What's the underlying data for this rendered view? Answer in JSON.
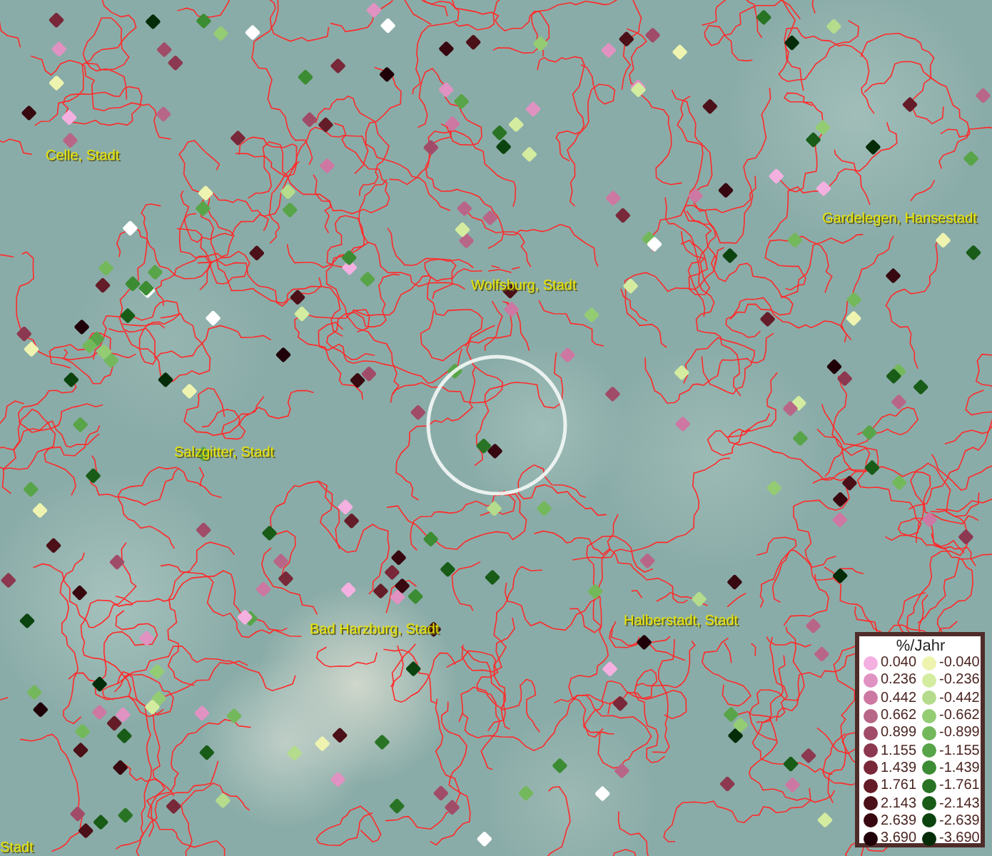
{
  "map": {
    "place_labels": [
      {
        "text": "Celle, Stadt"
      },
      {
        "text": "Gardelegen, Hansestadt"
      },
      {
        "text": "Wolfsburg, Stadt"
      },
      {
        "text": "Salzgitter, Stadt"
      },
      {
        "text": "Bad Harzburg, Stadt"
      },
      {
        "text": "Halberstadt, Stadt"
      },
      {
        "text": "Stadt"
      }
    ]
  },
  "legend": {
    "title": "%/Jahr",
    "entries": [
      {
        "label": "0.040",
        "color": "#f4b0e0"
      },
      {
        "label": "-0.040",
        "color": "#eef4b0"
      },
      {
        "label": "0.236",
        "color": "#e092c2"
      },
      {
        "label": "-0.236",
        "color": "#d4eca0"
      },
      {
        "label": "0.442",
        "color": "#cc78a2"
      },
      {
        "label": "-0.442",
        "color": "#b4dc8c"
      },
      {
        "label": "0.662",
        "color": "#b86688"
      },
      {
        "label": "-0.662",
        "color": "#94cc74"
      },
      {
        "label": "0.899",
        "color": "#a04c68"
      },
      {
        "label": "-0.899",
        "color": "#74b85c"
      },
      {
        "label": "1.155",
        "color": "#8c3850"
      },
      {
        "label": "-1.155",
        "color": "#58a448"
      },
      {
        "label": "1.439",
        "color": "#782838"
      },
      {
        "label": "-1.439",
        "color": "#3c8c34"
      },
      {
        "label": "1.761",
        "color": "#641c28"
      },
      {
        "label": "-1.761",
        "color": "#287424"
      },
      {
        "label": "2.143",
        "color": "#4c1018"
      },
      {
        "label": "-2.143",
        "color": "#185c18"
      },
      {
        "label": "2.639",
        "color": "#380810"
      },
      {
        "label": "-2.639",
        "color": "#0c4410"
      },
      {
        "label": "3.690",
        "color": "#200008"
      },
      {
        "label": "-3.690",
        "color": "#042c08"
      }
    ]
  }
}
